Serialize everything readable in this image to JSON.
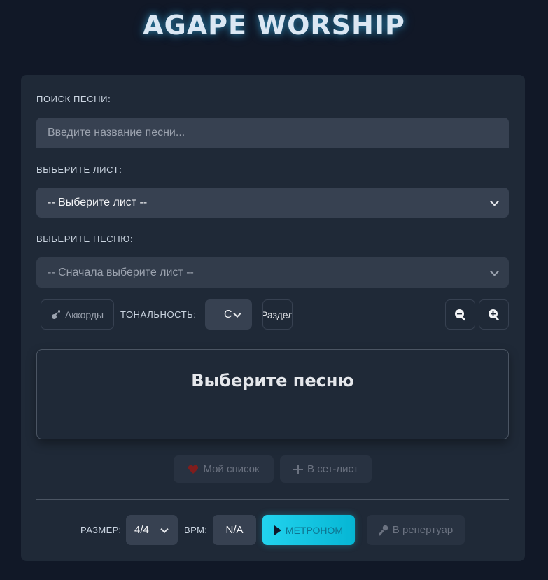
{
  "app": {
    "title": "AGAPE WORSHIP"
  },
  "search": {
    "label": "ПОИСК ПЕСНИ:",
    "placeholder": "Введите название песни..."
  },
  "sheet": {
    "label": "ВЫБЕРИТЕ ЛИСТ:",
    "selected": "-- Выберите лист --"
  },
  "song": {
    "label": "ВЫБЕРИТЕ ПЕСНЮ:",
    "selected": "-- Сначала выберите лист --"
  },
  "toolbar": {
    "chords_label": "Аккорды",
    "key_label": "ТОНАЛЬНОСТЬ:",
    "key_value": "C",
    "sections_label": "Раздел",
    "zoom_out_icon": "zoom-out-icon",
    "zoom_in_icon": "zoom-in-icon"
  },
  "viewer": {
    "title": "Выберите песню"
  },
  "actions": {
    "favorites_label": "Мой список",
    "setlist_label": "В сет-лист"
  },
  "bottom": {
    "size_label": "РАЗМЕР:",
    "size_value": "4/4",
    "bpm_label": "BPM:",
    "bpm_value": "N/A",
    "metronome_label": "МЕТРОНОМ",
    "repertoire_label": "В репертуар"
  },
  "colors": {
    "accent": "#22d3ee",
    "panel": "#1f2937",
    "background": "#111827",
    "heart": "#ef4444"
  }
}
